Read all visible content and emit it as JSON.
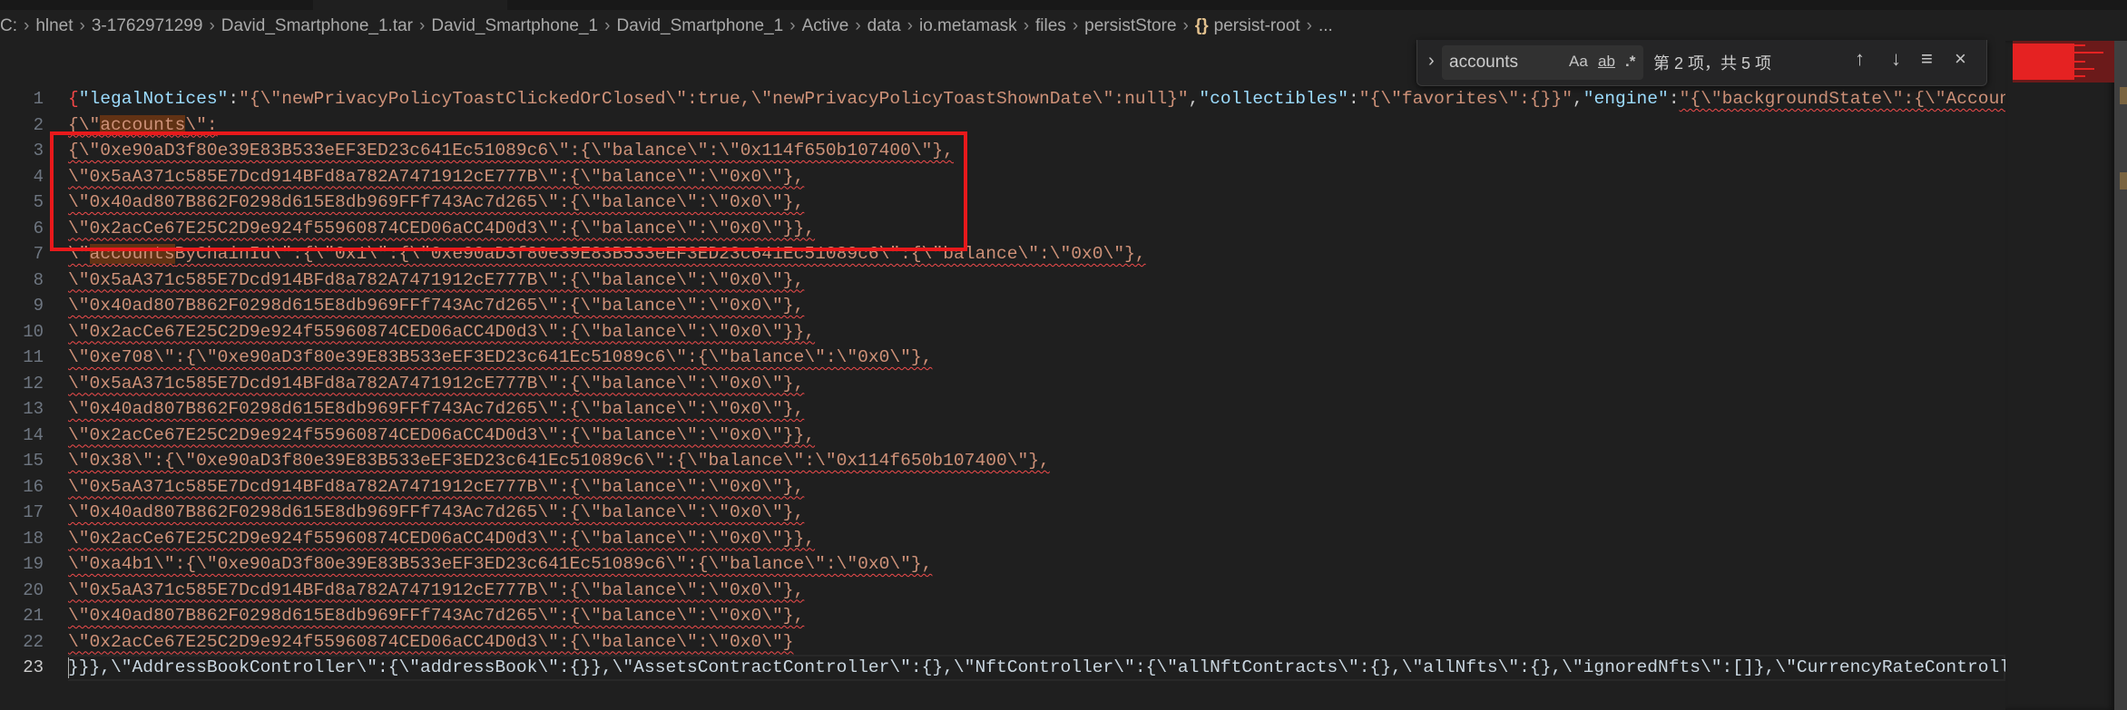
{
  "breadcrumb": [
    "C:",
    "hlnet",
    "3-1762971299",
    "David_Smartphone_1.tar",
    "David_Smartphone_1",
    "David_Smartphone_1",
    "Active",
    "data",
    "io.metamask",
    "files",
    "persistStore",
    "persist-root",
    "..."
  ],
  "breadcrumb_json_icon": "{}",
  "find": {
    "query": "accounts",
    "match_case": "Aa",
    "whole_word": "ab",
    "regex": ".*",
    "result_text": "第 2 项，共 5 项",
    "prev_icon": "↑",
    "next_icon": "↓",
    "selection_icon": "≡",
    "close_icon": "×"
  },
  "editor": {
    "active_line": "23",
    "lines": [
      {
        "n": "1",
        "segs": [
          {
            "t": "{",
            "c": "r"
          },
          {
            "t": "\"legalNotices\"",
            "c": "k"
          },
          {
            "t": ":",
            "c": "p"
          },
          {
            "t": "\"{\\\"newPrivacyPolicyToastClickedOrClosed\\\":true,\\\"newPrivacyPolicyToastShownDate\\\":null}\"",
            "c": "s"
          },
          {
            "t": ",",
            "c": "p"
          },
          {
            "t": "\"collectibles\"",
            "c": "k"
          },
          {
            "t": ":",
            "c": "p"
          },
          {
            "t": "\"{\\\"favorites\\\":{}}\"",
            "c": "s"
          },
          {
            "t": ",",
            "c": "p"
          },
          {
            "t": "\"engine\"",
            "c": "k"
          },
          {
            "t": ":",
            "c": "p"
          },
          {
            "t": "\"{\\\"backgroundState\\\":{\\\"AccountTr",
            "c": "s sq"
          }
        ]
      },
      {
        "n": "2",
        "segs": [
          {
            "t": "{\\\"",
            "c": "s sq"
          },
          {
            "t": "accounts",
            "c": "s sq m"
          },
          {
            "t": "\\\":",
            "c": "s sq"
          }
        ]
      },
      {
        "n": "3",
        "segs": [
          {
            "t": "{\\\"0xe90aD3f80e39E83B533eEF3ED23c641Ec51089c6\\\":{\\\"balance\\\":\\\"0x114f650b107400\\\"},",
            "c": "s sq"
          }
        ]
      },
      {
        "n": "4",
        "segs": [
          {
            "t": "\\\"0x5aA371c585E7Dcd914BFd8a782A7471912cE777B\\\":{\\\"balance\\\":\\\"0x0\\\"},",
            "c": "s sq"
          }
        ]
      },
      {
        "n": "5",
        "segs": [
          {
            "t": "\\\"0x40ad807B862F0298d615E8db969FFf743Ac7d265\\\":{\\\"balance\\\":\\\"0x0\\\"},",
            "c": "s sq"
          }
        ]
      },
      {
        "n": "6",
        "segs": [
          {
            "t": "\\\"0x2acCe67E25C2D9e924f55960874CED06aCC4D0d3\\\":{\\\"balance\\\":\\\"0x0\\\"}},",
            "c": "s sq"
          }
        ]
      },
      {
        "n": "7",
        "segs": [
          {
            "t": "\\\"",
            "c": "s sq"
          },
          {
            "t": "accounts",
            "c": "s sq m"
          },
          {
            "t": "ByChainId\\\":{\\\"0x1\\\":{\\\"0xe90aD3f80e39E83B533eEF3ED23c641Ec51089c6\\\":{\\\"balance\\\":\\\"0x0\\\"},",
            "c": "s sq"
          }
        ]
      },
      {
        "n": "8",
        "segs": [
          {
            "t": "\\\"0x5aA371c585E7Dcd914BFd8a782A7471912cE777B\\\":{\\\"balance\\\":\\\"0x0\\\"},",
            "c": "s sq"
          }
        ]
      },
      {
        "n": "9",
        "segs": [
          {
            "t": "\\\"0x40ad807B862F0298d615E8db969FFf743Ac7d265\\\":{\\\"balance\\\":\\\"0x0\\\"},",
            "c": "s sq"
          }
        ]
      },
      {
        "n": "10",
        "segs": [
          {
            "t": "\\\"0x2acCe67E25C2D9e924f55960874CED06aCC4D0d3\\\":{\\\"balance\\\":\\\"0x0\\\"}},",
            "c": "s sq"
          }
        ]
      },
      {
        "n": "11",
        "segs": [
          {
            "t": "\\\"0xe708\\\":{\\\"0xe90aD3f80e39E83B533eEF3ED23c641Ec51089c6\\\":{\\\"balance\\\":\\\"0x0\\\"},",
            "c": "s sq"
          }
        ]
      },
      {
        "n": "12",
        "segs": [
          {
            "t": "\\\"0x5aA371c585E7Dcd914BFd8a782A7471912cE777B\\\":{\\\"balance\\\":\\\"0x0\\\"},",
            "c": "s sq"
          }
        ]
      },
      {
        "n": "13",
        "segs": [
          {
            "t": "\\\"0x40ad807B862F0298d615E8db969FFf743Ac7d265\\\":{\\\"balance\\\":\\\"0x0\\\"},",
            "c": "s sq"
          }
        ]
      },
      {
        "n": "14",
        "segs": [
          {
            "t": "\\\"0x2acCe67E25C2D9e924f55960874CED06aCC4D0d3\\\":{\\\"balance\\\":\\\"0x0\\\"}},",
            "c": "s sq"
          }
        ]
      },
      {
        "n": "15",
        "segs": [
          {
            "t": "\\\"0x38\\\":{\\\"0xe90aD3f80e39E83B533eEF3ED23c641Ec51089c6\\\":{\\\"balance\\\":\\\"0x114f650b107400\\\"},",
            "c": "s sq"
          }
        ]
      },
      {
        "n": "16",
        "segs": [
          {
            "t": "\\\"0x5aA371c585E7Dcd914BFd8a782A7471912cE777B\\\":{\\\"balance\\\":\\\"0x0\\\"},",
            "c": "s sq"
          }
        ]
      },
      {
        "n": "17",
        "segs": [
          {
            "t": "\\\"0x40ad807B862F0298d615E8db969FFf743Ac7d265\\\":{\\\"balance\\\":\\\"0x0\\\"},",
            "c": "s sq"
          }
        ]
      },
      {
        "n": "18",
        "segs": [
          {
            "t": "\\\"0x2acCe67E25C2D9e924f55960874CED06aCC4D0d3\\\":{\\\"balance\\\":\\\"0x0\\\"}},",
            "c": "s sq"
          }
        ]
      },
      {
        "n": "19",
        "segs": [
          {
            "t": "\\\"0xa4b1\\\":{\\\"0xe90aD3f80e39E83B533eEF3ED23c641Ec51089c6\\\":{\\\"balance\\\":\\\"0x0\\\"},",
            "c": "s sq"
          }
        ]
      },
      {
        "n": "20",
        "segs": [
          {
            "t": "\\\"0x5aA371c585E7Dcd914BFd8a782A7471912cE777B\\\":{\\\"balance\\\":\\\"0x0\\\"},",
            "c": "s sq"
          }
        ]
      },
      {
        "n": "21",
        "segs": [
          {
            "t": "\\\"0x40ad807B862F0298d615E8db969FFf743Ac7d265\\\":{\\\"balance\\\":\\\"0x0\\\"},",
            "c": "s sq"
          }
        ]
      },
      {
        "n": "22",
        "segs": [
          {
            "t": "\\\"0x2acCe67E25C2D9e924f55960874CED06aCC4D0d3\\\":{\\\"balance\\\":\\\"0x0\\\"}",
            "c": "s sq"
          }
        ]
      },
      {
        "n": "23",
        "segs": [
          {
            "t": "}}},\\\"AddressBookController\\\":{\\\"addressBook\\\":{}},\\\"AssetsContractController\\\":{},\\\"NftController\\\":{\\\"allNftContracts\\\":{},\\\"allNfts\\\":{},\\\"ignoredNfts\\\":[]},\\\"CurrencyRateController\\",
            "c": "w"
          }
        ]
      }
    ]
  },
  "colors": {
    "highlight_box": "#e8191b",
    "string": "#ce9178",
    "key": "#9cdcfe",
    "match": "#613214"
  }
}
